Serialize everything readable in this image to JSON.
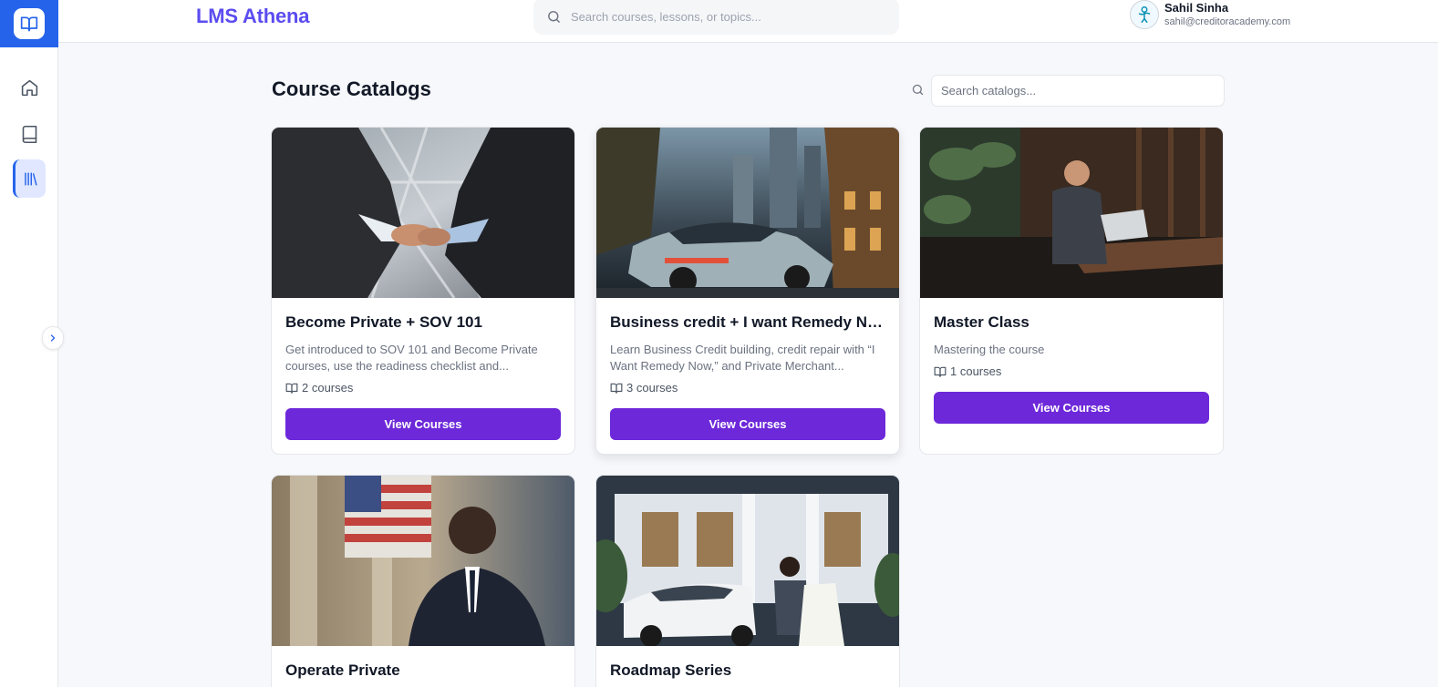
{
  "app": {
    "brand": "LMS Athena"
  },
  "header": {
    "search_placeholder": "Search courses, lessons, or topics...",
    "user": {
      "name": "Sahil Sinha",
      "email": "sahil@creditoracademy.com"
    }
  },
  "sidebar": {
    "items": [
      {
        "icon": "home-icon"
      },
      {
        "icon": "book-icon"
      },
      {
        "icon": "library-icon",
        "active": true
      }
    ],
    "accent": "#2563eb"
  },
  "page": {
    "title": "Course Catalogs",
    "search_placeholder": "Search catalogs..."
  },
  "catalogs": [
    {
      "title": "Become Private + SOV 101",
      "description": "Get introduced to SOV 101 and Become Private courses, use the readiness checklist and...",
      "count": "2 courses",
      "button": "View Courses",
      "image": "handshake-photo"
    },
    {
      "title": "Business credit + I want Remedy No...",
      "description": "Learn Business Credit building, credit repair with “I Want Remedy Now,” and Private Merchant...",
      "count": "3 courses",
      "button": "View Courses",
      "image": "sports-car-city-photo"
    },
    {
      "title": "Master Class",
      "description": "Mastering the course",
      "count": "1 courses",
      "button": "View Courses",
      "image": "man-laptop-lounge-photo"
    },
    {
      "title": "Operate Private",
      "image": "man-suit-flag-photo"
    },
    {
      "title": "Roadmap Series",
      "image": "couple-car-mansion-photo"
    }
  ],
  "colors": {
    "brand": "#5b4cf0",
    "button": "#6d28d9",
    "nav_active": "#2563eb"
  }
}
